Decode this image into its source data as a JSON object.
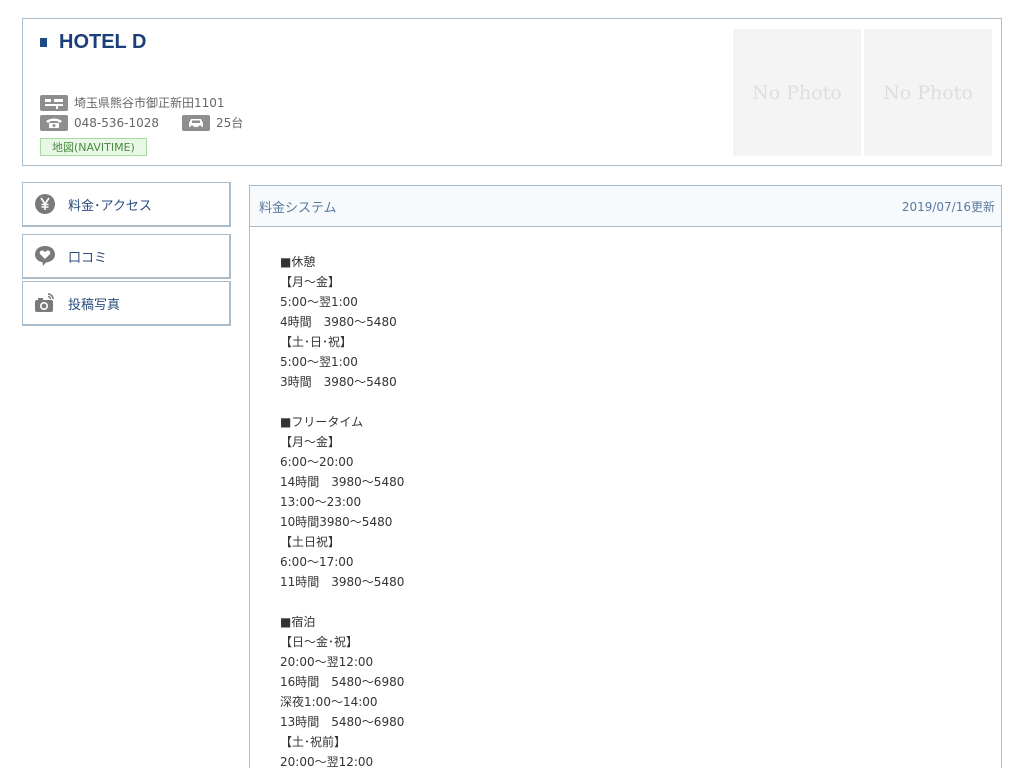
{
  "hotel": {
    "name": "HOTEL D",
    "address": "埼玉県熊谷市御正新田1101",
    "tel": "048-536-1028",
    "parking": "25台",
    "map_link": "地図(NAVITIME)",
    "photos": [
      "No Photo",
      "No Photo"
    ]
  },
  "nav": {
    "items": [
      {
        "label": "料金･アクセス",
        "icon": "yen-icon"
      },
      {
        "label": "口コミ",
        "icon": "heart-speech-icon"
      },
      {
        "label": "投稿写真",
        "icon": "camera-icon"
      }
    ]
  },
  "content": {
    "title": "料金システム",
    "updated": "2019/07/16更新",
    "sections": [
      {
        "lines": [
          "■休憩",
          "【月～金】",
          "5:00～翌1:00",
          "4時間　3980～5480",
          "【土･日･祝】",
          "5:00～翌1:00",
          "3時間　3980～5480"
        ]
      },
      {
        "lines": [
          "■フリータイム",
          "【月～金】",
          "6:00～20:00",
          "14時間　3980～5480",
          "13:00～23:00",
          "10時間3980～5480",
          "【土日祝】",
          "6:00～17:00",
          "11時間　3980～5480"
        ]
      },
      {
        "lines": [
          "■宿泊",
          "【日～金･祝】",
          "20:00～翌12:00",
          "16時間　5480～6980",
          "深夜1:00～14:00",
          "13時間　5480～6980",
          "【土･祝前】",
          "20:00～翌12:00"
        ]
      }
    ]
  }
}
